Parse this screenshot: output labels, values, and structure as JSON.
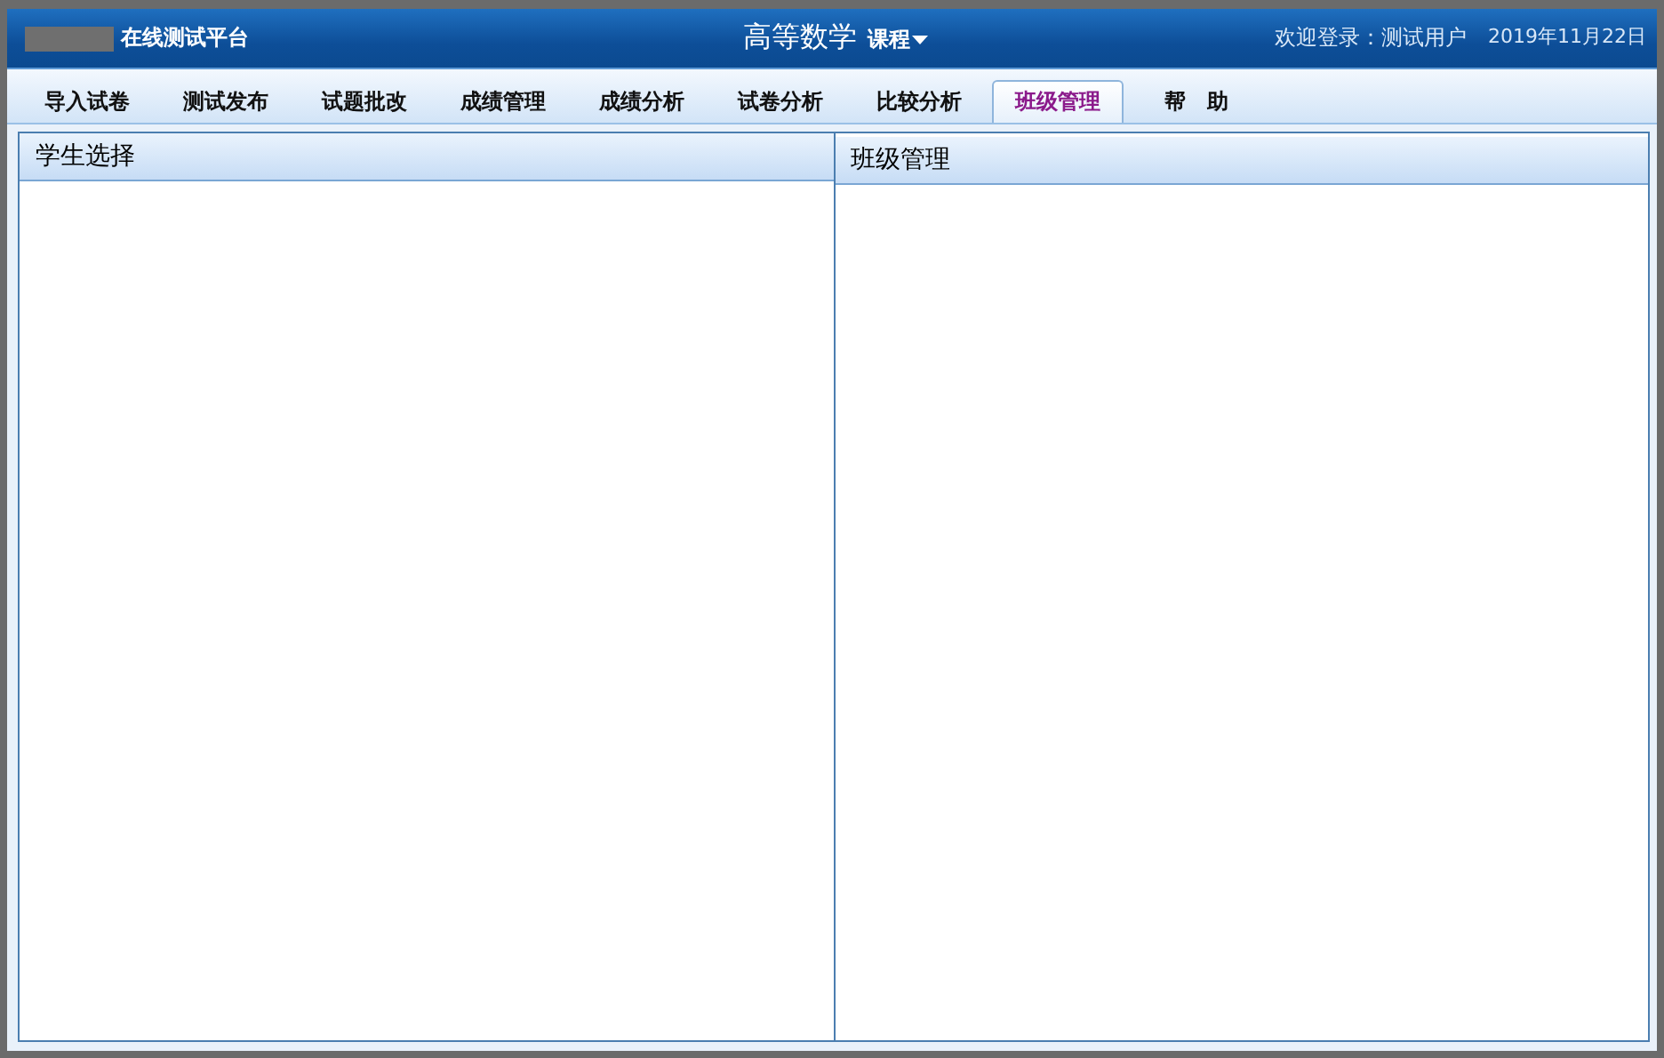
{
  "header": {
    "platform": "在线测试平台",
    "course": "高等数学",
    "course_menu": "课程",
    "welcome": "欢迎登录：测试用户",
    "date": "2019年11月22日"
  },
  "tabs": [
    {
      "label": "导入试卷",
      "selected": false
    },
    {
      "label": "测试发布",
      "selected": false
    },
    {
      "label": "试题批改",
      "selected": false
    },
    {
      "label": "成绩管理",
      "selected": false
    },
    {
      "label": "成绩分析",
      "selected": false
    },
    {
      "label": "试卷分析",
      "selected": false
    },
    {
      "label": "比较分析",
      "selected": false
    },
    {
      "label": "班级管理",
      "selected": true
    },
    {
      "label": "帮　助",
      "selected": false
    }
  ],
  "panels": [
    {
      "title": "学生选择"
    },
    {
      "title": "班级管理"
    }
  ]
}
